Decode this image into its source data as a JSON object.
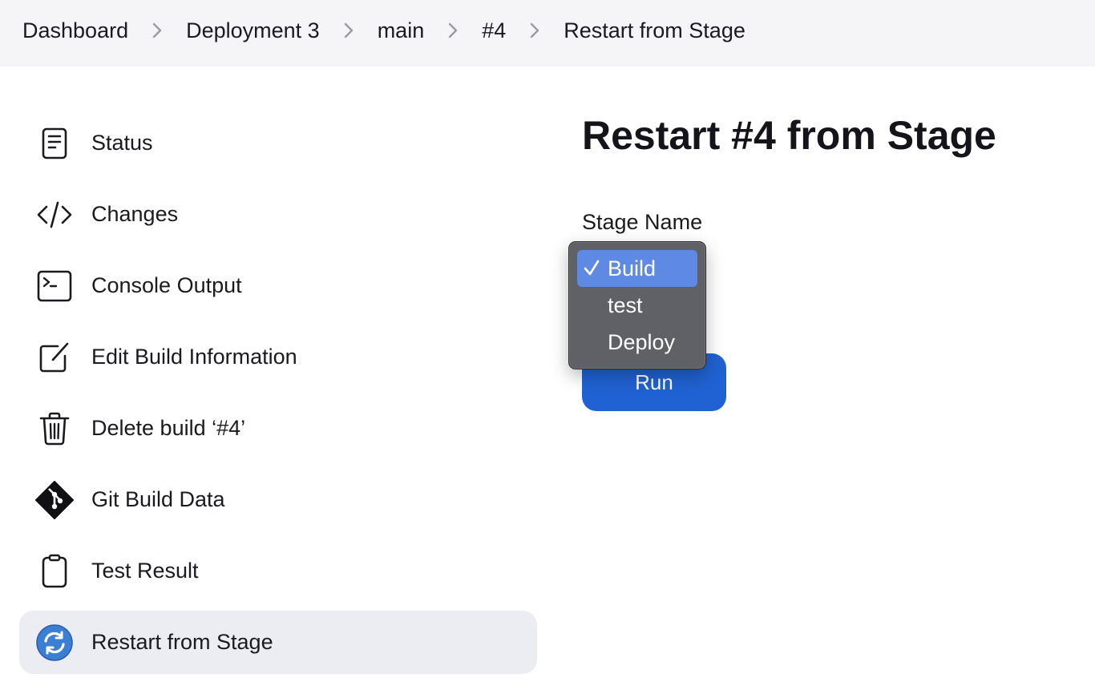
{
  "breadcrumb": {
    "items": [
      "Dashboard",
      "Deployment 3",
      "main",
      "#4",
      "Restart from Stage"
    ]
  },
  "sidebar": {
    "items": [
      {
        "label": "Status",
        "icon": "document-icon"
      },
      {
        "label": "Changes",
        "icon": "code-icon"
      },
      {
        "label": "Console Output",
        "icon": "terminal-icon"
      },
      {
        "label": "Edit Build Information",
        "icon": "edit-icon"
      },
      {
        "label": "Delete build ‘#4’",
        "icon": "trash-icon"
      },
      {
        "label": "Git Build Data",
        "icon": "git-icon"
      },
      {
        "label": "Test Result",
        "icon": "clipboard-icon"
      },
      {
        "label": "Restart from Stage",
        "icon": "restart-icon",
        "active": true
      }
    ]
  },
  "main": {
    "title": "Restart #4 from Stage",
    "field_label": "Stage Name",
    "dropdown": {
      "selected": "Build",
      "options": [
        "Build",
        "test",
        "Deploy"
      ]
    },
    "run_label": "Run"
  },
  "colors": {
    "accent": "#2062d3",
    "selected_option": "#5f8ae4",
    "menu_bg": "#5f6166",
    "active_item_bg": "#ebedf3",
    "topbar_bg": "#f5f5f7"
  }
}
